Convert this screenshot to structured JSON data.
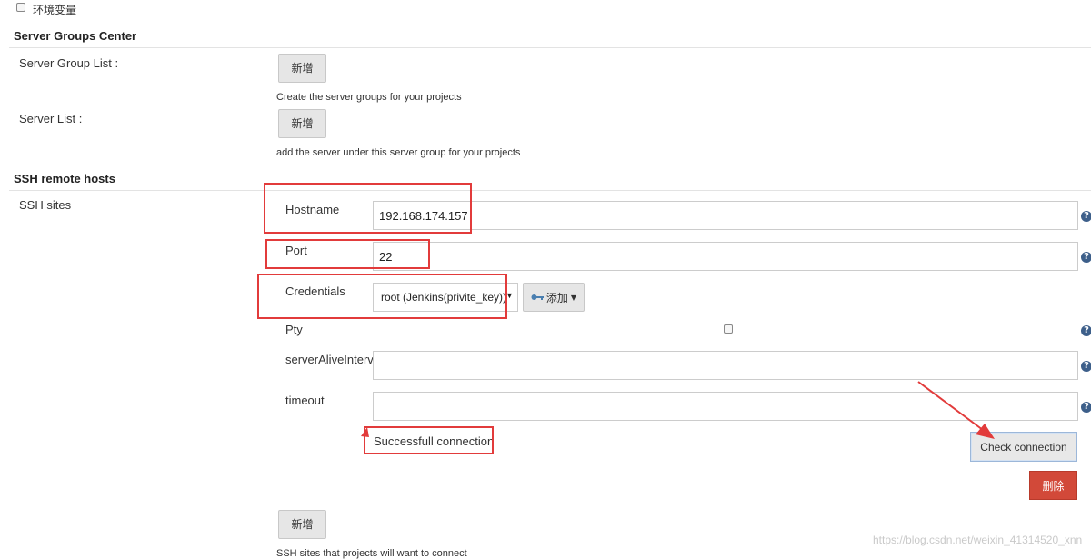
{
  "env_vars": {
    "label": "环境变量",
    "checked": false
  },
  "server_groups": {
    "title": "Server Groups Center",
    "group_list_label": "Server Group List :",
    "group_add_button": "新增",
    "group_desc": "Create the server groups for your projects",
    "server_list_label": "Server List :",
    "server_add_button": "新增",
    "server_desc": "add the server under this server group for your projects"
  },
  "ssh": {
    "title": "SSH remote hosts",
    "sites_label": "SSH sites",
    "hostname_label": "Hostname",
    "hostname_value": "192.168.174.157",
    "port_label": "Port",
    "port_value": "22",
    "credentials_label": "Credentials",
    "credentials_value": "root (Jenkins(privite_key))",
    "add_credentials_button": "添加",
    "pty_label": "Pty",
    "pty_checked": false,
    "server_alive_label": "serverAliveInterval",
    "server_alive_value": "",
    "timeout_label": "timeout",
    "timeout_value": "",
    "status_text": "Successfull connection",
    "check_connection_button": "Check connection",
    "delete_button": "删除",
    "sites_add_button": "新增",
    "sites_desc": "SSH sites that projects will want to connect"
  },
  "help_icon_glyph": "?",
  "watermark": "https://blog.csdn.net/weixin_41314520_xnn",
  "colors": {
    "highlight_red": "#e23b3b",
    "delete_red": "#d24939",
    "help_blue": "#3d5f8a",
    "key_icon": "#4a7fb0"
  }
}
